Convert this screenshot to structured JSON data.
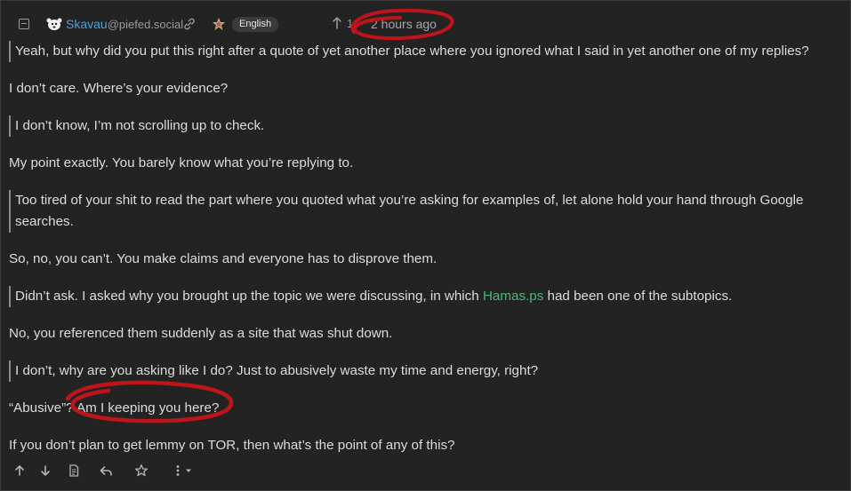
{
  "comment": {
    "author_name": "Skavau",
    "author_instance": "@piefed.social",
    "language": "English",
    "score": "1",
    "separator": "·",
    "time_ago": "2 hours ago",
    "body": [
      {
        "type": "quote",
        "text": "Yeah, but why did you put this right after a quote of yet another place where you ignored what I said in yet another one of my replies?"
      },
      {
        "type": "para",
        "text": "I don’t care. Where’s your evidence?"
      },
      {
        "type": "quote",
        "text": "I don’t know, I’m not scrolling up to check."
      },
      {
        "type": "para",
        "text": "My point exactly. You barely know what you’re replying to."
      },
      {
        "type": "quote",
        "text": "Too tired of your shit to read the part where you quoted what you’re asking for examples of, let alone hold your hand through Google searches."
      },
      {
        "type": "para",
        "text": "So, no, you can’t. You make claims and everyone has to disprove them."
      },
      {
        "type": "quote_link",
        "before": "Didn’t ask. I asked why you brought up the topic we were discussing, in which ",
        "link": "Hamas.ps",
        "after": " had been one of the subtopics."
      },
      {
        "type": "para",
        "text": "No, you referenced them suddenly as a site that was shut down."
      },
      {
        "type": "quote",
        "text": "I don’t, why are you asking like I do? Just to abusively waste my time and energy, right?"
      },
      {
        "type": "para",
        "text": "“Abusive”? Am I keeping you here?"
      },
      {
        "type": "para",
        "text": "If you don’t plan to get lemmy on TOR, then what’s the point of any of this?"
      }
    ]
  },
  "colors": {
    "background": "#232323",
    "username": "#4ea1d8",
    "link": "#4fb37d",
    "annotation": "#c0141b"
  },
  "icons": {
    "collapse": "minus-square-icon",
    "avatar": "avatar-icon",
    "permalink": "link-icon",
    "language": "language-icon",
    "upvote": "arrow-up-icon",
    "action_upvote": "arrow-up-icon",
    "action_downvote": "arrow-down-icon",
    "action_view_source": "document-icon",
    "action_reply": "reply-icon",
    "action_bookmark": "star-icon",
    "action_more": "more-icon"
  }
}
